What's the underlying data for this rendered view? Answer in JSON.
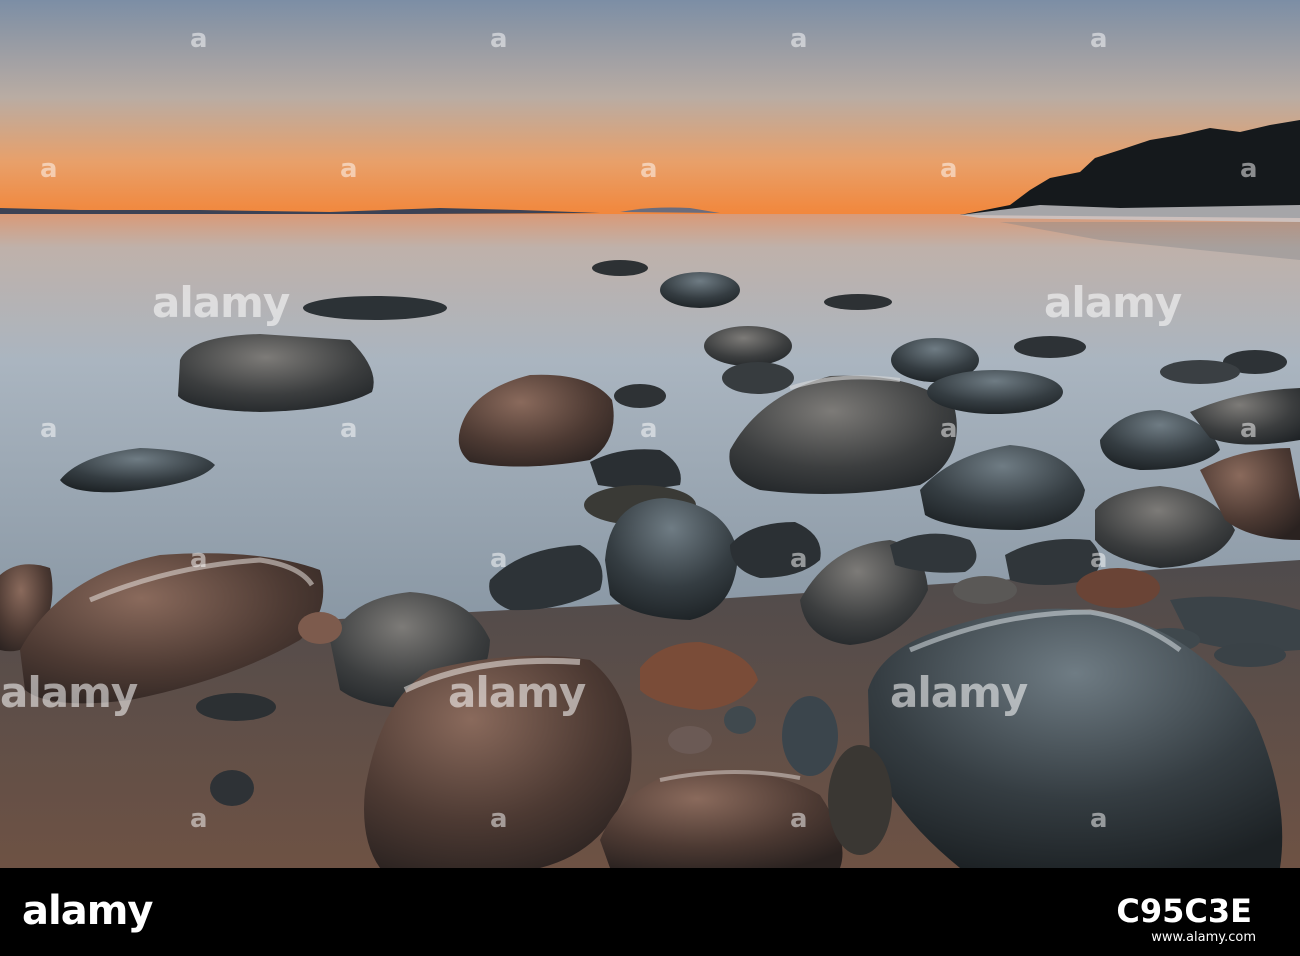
{
  "image": {
    "subject": "sunset-coast-rocks",
    "palette": {
      "sky_top": "#7d8fa6",
      "sky_mid": "#c9b2a0",
      "horizon_glow": "#f08a3c",
      "water": "#aeb8c4",
      "rock_dark": "#2f3538",
      "sand": "#6e5647"
    }
  },
  "watermark": {
    "text": "alamy",
    "small_text": "a"
  },
  "footer": {
    "logo_text": "alamy",
    "photo_id": "C95C3E",
    "website": "www.alamy.com"
  }
}
